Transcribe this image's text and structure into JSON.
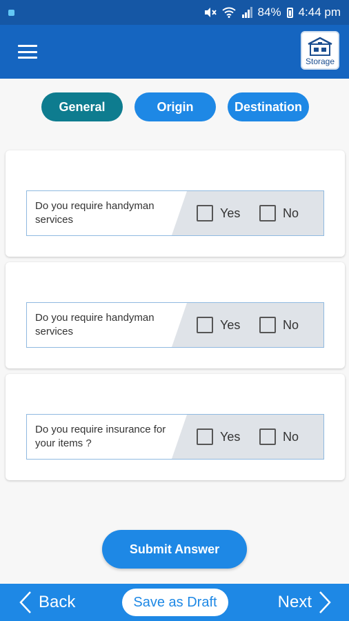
{
  "status_bar": {
    "battery": "84%",
    "time": "4:44 pm"
  },
  "app_bar": {
    "storage_label": "Storage"
  },
  "tabs": [
    {
      "label": "General",
      "active": true
    },
    {
      "label": "Origin",
      "active": false
    },
    {
      "label": "Destination",
      "active": false
    }
  ],
  "questions": [
    {
      "text": "Do you require handyman services",
      "yes_label": "Yes",
      "no_label": "No",
      "yes_checked": false,
      "no_checked": false
    },
    {
      "text": "Do you require handyman services",
      "yes_label": "Yes",
      "no_label": "No",
      "yes_checked": false,
      "no_checked": false
    },
    {
      "text": "Do you require insurance for your items ?",
      "yes_label": "Yes",
      "no_label": "No",
      "yes_checked": false,
      "no_checked": false
    }
  ],
  "submit_label": "Submit Answer",
  "bottom_bar": {
    "back_label": "Back",
    "draft_label": "Save as Draft",
    "next_label": "Next"
  },
  "colors": {
    "status_bar": "#1557a5",
    "app_bar": "#1565c0",
    "tab_active": "#0e7c8f",
    "tab_inactive": "#1e88e5",
    "primary": "#1e88e5"
  }
}
